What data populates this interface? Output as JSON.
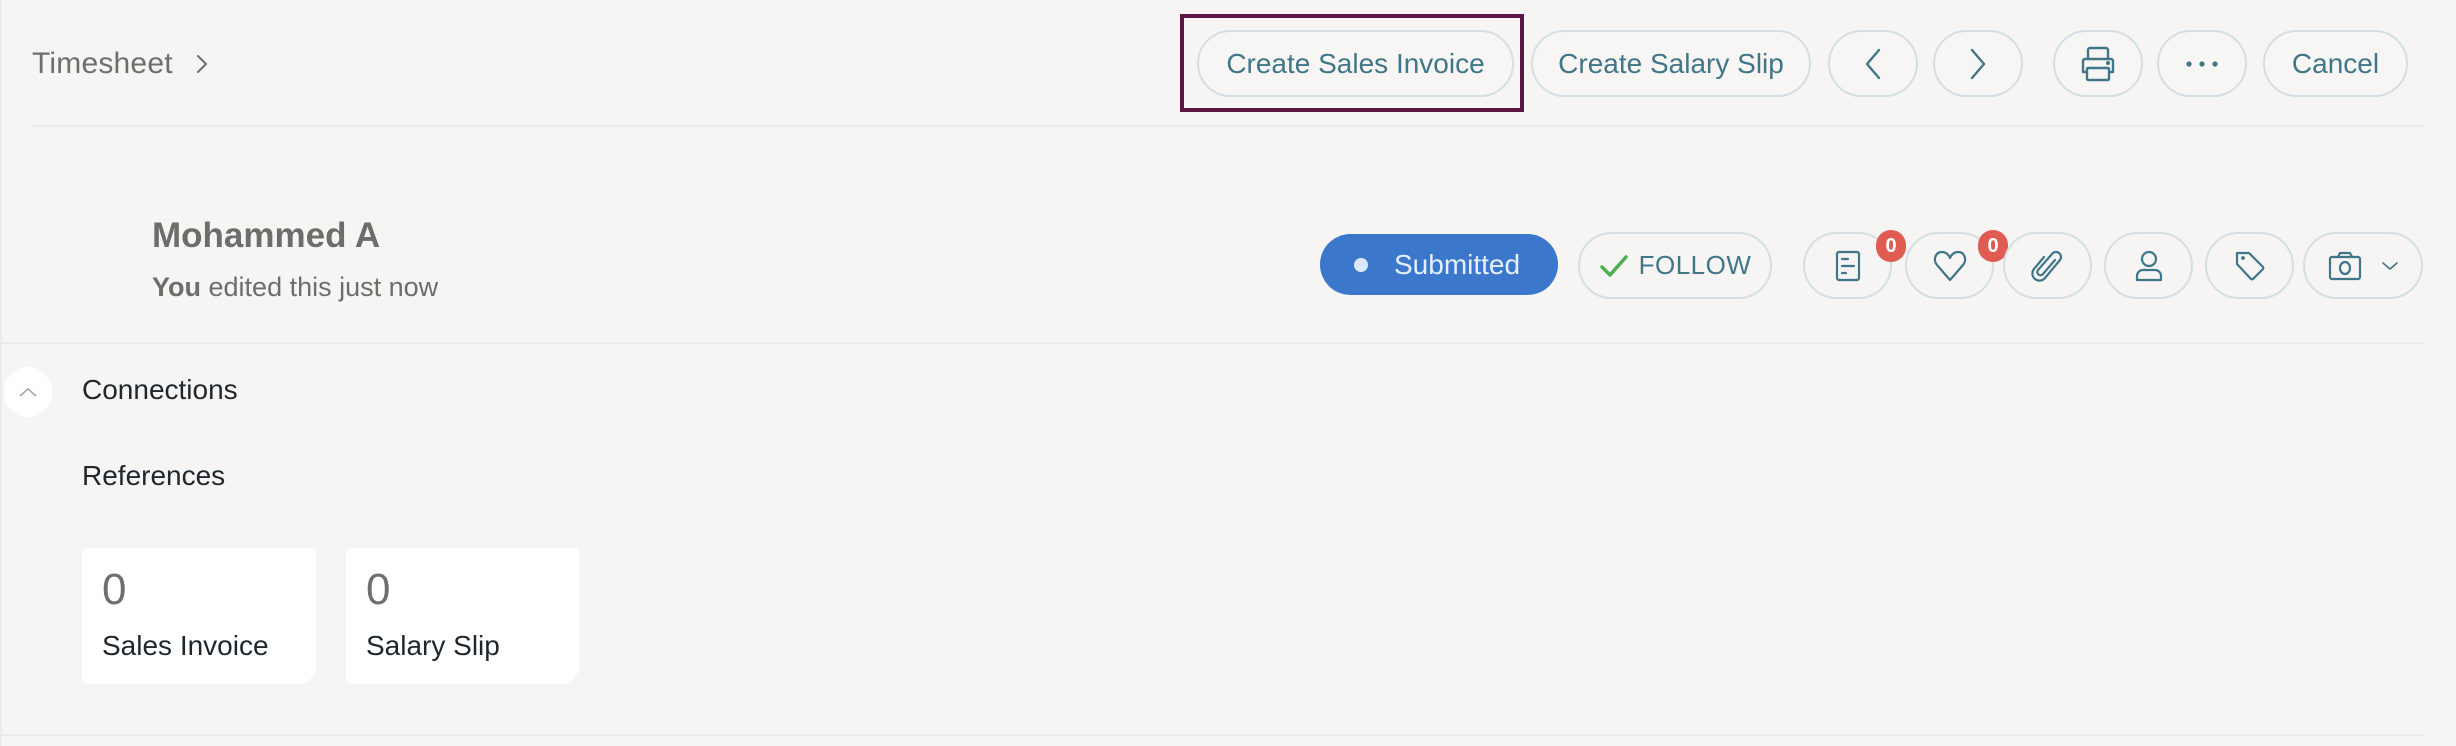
{
  "header": {
    "breadcrumb": "Timesheet",
    "buttons": {
      "create_sales_invoice": "Create Sales Invoice",
      "create_salary_slip": "Create Salary Slip",
      "prev_icon": "chevron-left-icon",
      "next_icon": "chevron-right-icon",
      "print_icon": "printer-icon",
      "more_icon": "more-horizontal-icon",
      "cancel": "Cancel"
    }
  },
  "record": {
    "title": "Mohammed A",
    "editor": "You",
    "edited_text": "edited this",
    "edited_when": "just now",
    "status": "Submitted",
    "status_color": "#3b78cb",
    "follow_label": "FOLLOW",
    "actions": [
      {
        "icon": "comment-icon",
        "badge": "0"
      },
      {
        "icon": "heart-icon",
        "badge": "0"
      },
      {
        "icon": "paperclip-icon"
      },
      {
        "icon": "user-icon"
      },
      {
        "icon": "tag-icon"
      },
      {
        "icon": "camera-icon"
      }
    ]
  },
  "connections": {
    "title": "Connections",
    "section": "References",
    "cards": [
      {
        "count": "0",
        "label": "Sales Invoice"
      },
      {
        "count": "0",
        "label": "Salary Slip"
      }
    ]
  },
  "colors": {
    "accent": "#3f7688",
    "badge": "#e05c52",
    "highlight": "#5b1744",
    "follow_check": "#4caf50"
  }
}
